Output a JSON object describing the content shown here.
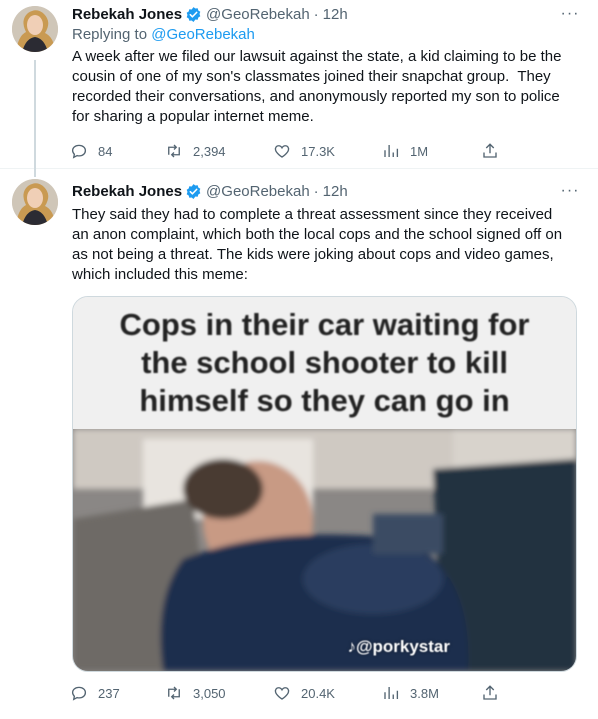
{
  "tweets": [
    {
      "author": {
        "name": "Rebekah Jones",
        "handle": "@GeoRebekah",
        "verified": true
      },
      "time": "12h",
      "replying_prefix": "Replying to",
      "replying_to": "@GeoRebekah",
      "text": "A week after we filed our lawsuit against the state, a kid claiming to be the cousin of one of my son's classmates joined their snapchat group.  They recorded their conversations, and anonymously reported my son to police for sharing a popular internet meme.",
      "stats": {
        "replies": "84",
        "retweets": "2,394",
        "likes": "17.3K",
        "views": "1M"
      }
    },
    {
      "author": {
        "name": "Rebekah Jones",
        "handle": "@GeoRebekah",
        "verified": true
      },
      "time": "12h",
      "text": "They said they had to complete a threat assessment since they received an anon complaint, which both the local cops and the school signed off on as not being a threat. The kids were joking about cops and video games, which included this meme:",
      "media": {
        "caption_lines": [
          "Cops in their car waiting for",
          "the school shooter to kill",
          "himself so they can go in"
        ],
        "watermark": "@porkystar"
      },
      "stats": {
        "replies": "237",
        "retweets": "3,050",
        "likes": "20.4K",
        "views": "3.8M"
      }
    }
  ],
  "icons": [
    "verified-badge-icon",
    "more-icon",
    "reply-icon",
    "retweet-icon",
    "like-icon",
    "views-icon",
    "share-icon",
    "tiktok-icon"
  ],
  "colors": {
    "accent": "#1d9bf0",
    "secondary_text": "#536471",
    "primary_text": "#0f1419"
  }
}
